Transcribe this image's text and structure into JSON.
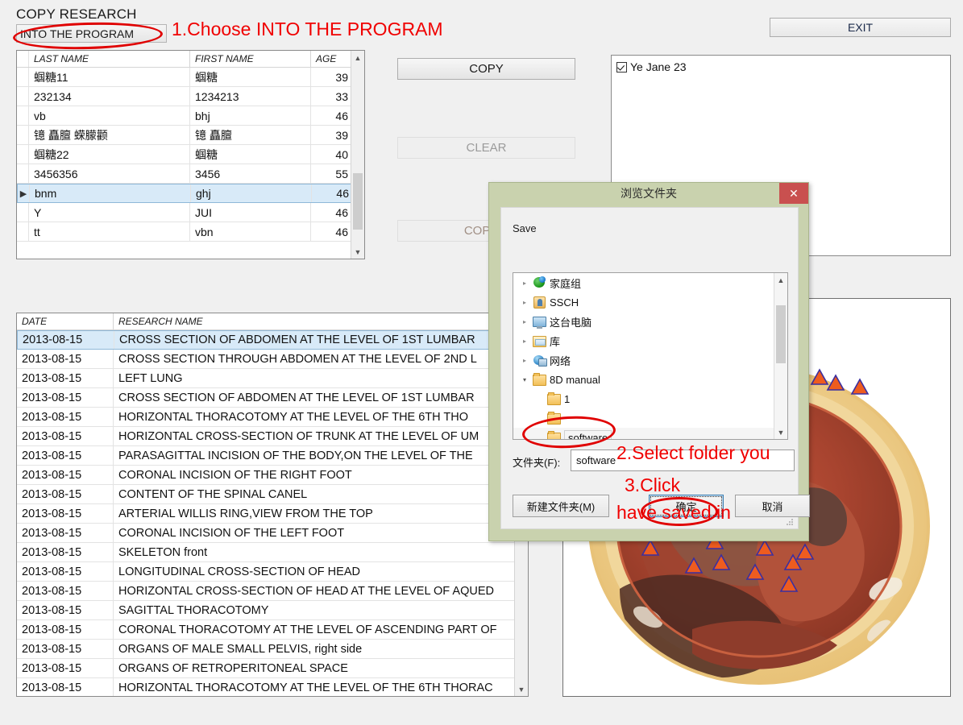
{
  "app": {
    "copy_research_label": "COPY RESEARCH",
    "into_program_button": "INTO THE PROGRAM",
    "exit_button": "EXIT"
  },
  "annotations": {
    "step1": "1.Choose INTO THE PROGRAM",
    "step2_line1": "2.Select folder you",
    "step2_line2": "have saved in",
    "step3": "3.Click"
  },
  "people_grid": {
    "headers": [
      "LAST NAME",
      "FIRST NAME",
      "AGE"
    ],
    "rows": [
      {
        "marker": "",
        "last": "蝈糖11",
        "first": "蝈糖",
        "age": "39",
        "selected": false
      },
      {
        "marker": "",
        "last": "232134",
        "first": "1234213",
        "age": "33",
        "selected": false
      },
      {
        "marker": "",
        "last": "vb",
        "first": "bhj",
        "age": "46",
        "selected": false
      },
      {
        "marker": "",
        "last": "  镱 矗膻 蝾朦颧",
        "first": "镱 矗膻",
        "age": "39",
        "selected": false
      },
      {
        "marker": "",
        "last": "蝈糖22",
        "first": "蝈糖",
        "age": "40",
        "selected": false
      },
      {
        "marker": "",
        "last": "3456356",
        "first": "3456",
        "age": "55",
        "selected": false
      },
      {
        "marker": "▶",
        "last": "bnm",
        "first": "ghj",
        "age": "46",
        "selected": true
      },
      {
        "marker": "",
        "last": "Y",
        "first": "JUI",
        "age": "46",
        "selected": false
      },
      {
        "marker": "",
        "last": "tt",
        "first": "vbn",
        "age": "46",
        "selected": false
      }
    ]
  },
  "middle_buttons": {
    "copy": "COPY",
    "clear": "CLEAR",
    "copy_to": "COPY T"
  },
  "selected_list": {
    "items": [
      {
        "checked": true,
        "label": "Ye Jane   23"
      }
    ]
  },
  "research_grid": {
    "headers": [
      "DATE",
      "RESEARCH NAME"
    ],
    "rows": [
      {
        "date": "2013-08-15",
        "name": "CROSS SECTION OF ABDOMEN AT THE LEVEL OF 1ST LUMBAR",
        "selected": true
      },
      {
        "date": "2013-08-15",
        "name": "CROSS SECTION THROUGH ABDOMEN AT THE LEVEL OF 2ND L",
        "selected": false
      },
      {
        "date": "2013-08-15",
        "name": "LEFT  LUNG",
        "selected": false
      },
      {
        "date": "2013-08-15",
        "name": "CROSS SECTION OF ABDOMEN AT THE LEVEL OF 1ST LUMBAR",
        "selected": false
      },
      {
        "date": "2013-08-15",
        "name": "HORIZONTAL THORACOTOMY AT THE LEVEL OF THE 6TH THO",
        "selected": false
      },
      {
        "date": "2013-08-15",
        "name": "HORIZONTAL CROSS-SECTION OF TRUNK AT THE LEVEL OF UM",
        "selected": false
      },
      {
        "date": "2013-08-15",
        "name": "PARASAGITTAL INCISION OF THE BODY,ON THE LEVEL OF THE",
        "selected": false
      },
      {
        "date": "2013-08-15",
        "name": "CORONAL INCISION OF THE RIGHT FOOT",
        "selected": false
      },
      {
        "date": "2013-08-15",
        "name": "CONTENT OF THE SPINAL CANEL",
        "selected": false
      },
      {
        "date": "2013-08-15",
        "name": "ARTERIAL WILLIS RING,VIEW FROM THE TOP",
        "selected": false
      },
      {
        "date": "2013-08-15",
        "name": "CORONAL INCISION OF THE LEFT FOOT",
        "selected": false
      },
      {
        "date": "2013-08-15",
        "name": "SKELETON front",
        "selected": false
      },
      {
        "date": "2013-08-15",
        "name": "LONGITUDINAL CROSS-SECTION OF HEAD",
        "selected": false
      },
      {
        "date": "2013-08-15",
        "name": "HORIZONTAL CROSS-SECTION OF HEAD AT THE LEVEL OF AQUED",
        "selected": false
      },
      {
        "date": "2013-08-15",
        "name": "SAGITTAL THORACOTOMY",
        "selected": false
      },
      {
        "date": "2013-08-15",
        "name": "CORONAL THORACOTOMY AT THE LEVEL OF ASCENDING PART OF",
        "selected": false
      },
      {
        "date": "2013-08-15",
        "name": "ORGANS OF MALE SMALL PELVIS, right side",
        "selected": false
      },
      {
        "date": "2013-08-15",
        "name": "ORGANS OF RETROPERITONEAL SPACE",
        "selected": false
      },
      {
        "date": "2013-08-15",
        "name": "HORIZONTAL THORACOTOMY AT THE LEVEL OF THE 6TH THORAC",
        "selected": false
      }
    ]
  },
  "browse_dialog": {
    "title": "浏览文件夹",
    "close_label": "✕",
    "save_label": "Save",
    "tree": [
      {
        "label": "家庭组",
        "icon": "homegroup-icon",
        "expander": "collapsed",
        "indent": 0
      },
      {
        "label": "SSCH",
        "icon": "user-folder-icon",
        "expander": "collapsed",
        "indent": 0
      },
      {
        "label": "这台电脑",
        "icon": "computer-icon",
        "expander": "collapsed",
        "indent": 0
      },
      {
        "label": "库",
        "icon": "library-icon",
        "expander": "collapsed",
        "indent": 0
      },
      {
        "label": "网络",
        "icon": "network-icon",
        "expander": "collapsed",
        "indent": 0
      },
      {
        "label": "8D manual",
        "icon": "folder-icon",
        "expander": "expanded",
        "indent": 0
      },
      {
        "label": "1",
        "icon": "folder-icon",
        "expander": "none",
        "indent": 1
      },
      {
        "label": "",
        "icon": "folder-icon",
        "expander": "none",
        "indent": 1
      },
      {
        "label": "software",
        "icon": "folder-icon",
        "expander": "none",
        "indent": 1,
        "selected": true
      }
    ],
    "folder_field_label": "文件夹(F):",
    "folder_field_value": "software",
    "new_folder_button": "新建文件夹(M)",
    "ok_button": "确定",
    "cancel_button": "取消"
  },
  "image_panel": {
    "alt": "anatomical-cross-section-with-markers"
  },
  "colors": {
    "annotation_red": "#f00000",
    "dialog_frame": "#c9d2ae",
    "close_red": "#c9504f",
    "row_selection": "#d8eaf8"
  }
}
